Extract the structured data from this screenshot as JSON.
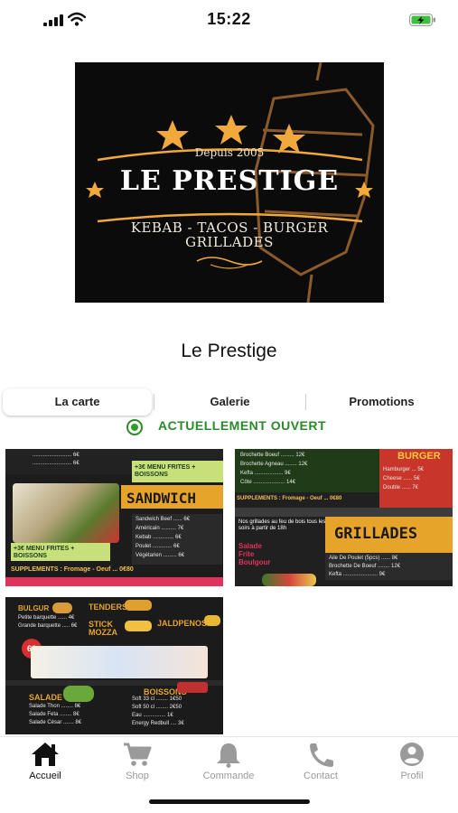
{
  "status_bar": {
    "time": "15:22",
    "icons": [
      "cellular-signal-icon",
      "wifi-icon",
      "battery-charging-icon"
    ],
    "battery_color": "#3fbf3f"
  },
  "logo": {
    "since": "Depuis 2005",
    "name": "LE PRESTIGE",
    "tagline_1": "KEBAB - TACOS - BURGER",
    "tagline_2": "GRILLADES",
    "colors": {
      "background": "#0b0b0b",
      "gold": "#f0a93a",
      "line": "#c98a3a"
    }
  },
  "restaurant": {
    "name": "Le Prestige"
  },
  "tabs": [
    {
      "label": "La carte",
      "active": true
    },
    {
      "label": "Galerie",
      "active": false
    },
    {
      "label": "Promotions",
      "active": false
    }
  ],
  "open_status": {
    "text": "ACTUELLEMENT OUVERT",
    "color": "#2b8a2b"
  },
  "menu_photos": {
    "sandwich": {
      "heading": "SANDWICH",
      "promo": "+3€ MENU FRITES + BOISSONS",
      "promo_top": "+3€ MENU FRITES + BOISSONS",
      "supplements": "SUPPLEMENTS : Fromage - Oeuf ... 0€80"
    },
    "grillades": {
      "heading": "GRILLADES",
      "corner": "BURGER",
      "side_1": "Salade",
      "side_2": "Frite",
      "side_3": "Boulgour",
      "supplements": "SUPPLEMENTS : Fromage - Oeuf ... 0€80",
      "note": "Nos grillades au feu de bois tous les soirs à partir de 18h"
    },
    "sides": {
      "tenders": "TENDERS",
      "stick": "STICK MOZZA",
      "jalapenos": "JALDPENOS",
      "bulgur": "BULGUR",
      "salade": "SALADE",
      "boissons": "BOISSONS",
      "kids": "6€"
    }
  },
  "bottom_nav": [
    {
      "label": "Accueil",
      "icon": "home-icon",
      "active": true
    },
    {
      "label": "Shop",
      "icon": "shopping-cart-icon",
      "active": false
    },
    {
      "label": "Commande",
      "icon": "bell-icon",
      "active": false
    },
    {
      "label": "Contact",
      "icon": "phone-icon",
      "active": false
    },
    {
      "label": "Profil",
      "icon": "user-profile-icon",
      "active": false
    }
  ]
}
